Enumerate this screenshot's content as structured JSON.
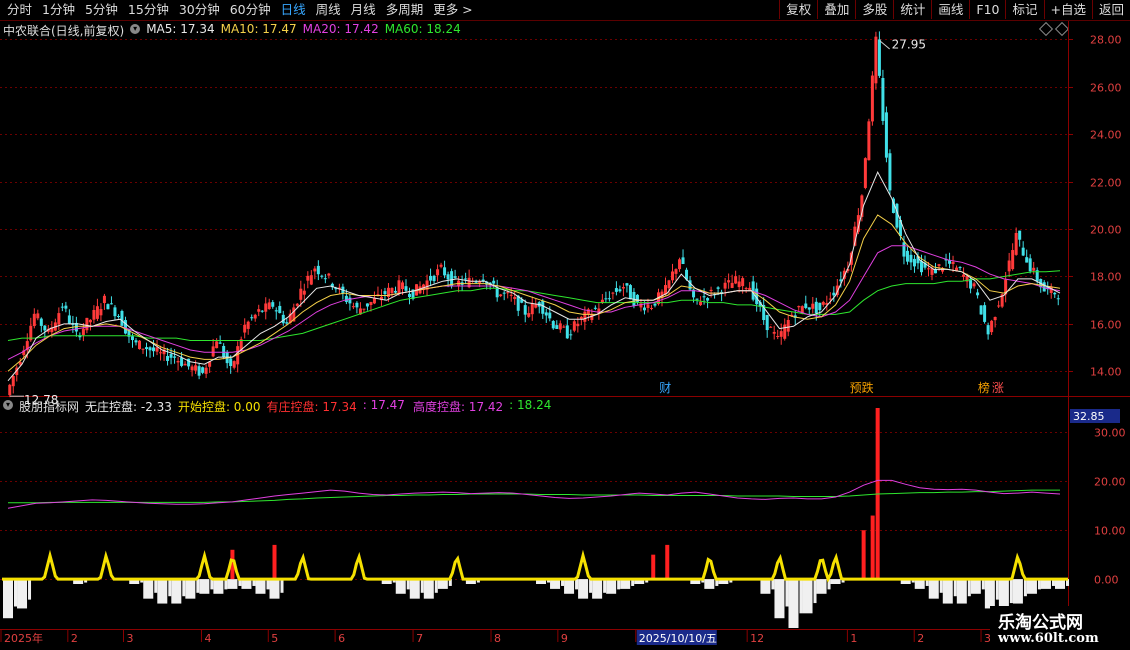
{
  "toolbar": {
    "periods": [
      {
        "label": "分时",
        "active": false
      },
      {
        "label": "1分钟",
        "active": false
      },
      {
        "label": "5分钟",
        "active": false
      },
      {
        "label": "15分钟",
        "active": false
      },
      {
        "label": "30分钟",
        "active": false
      },
      {
        "label": "60分钟",
        "active": false
      },
      {
        "label": "日线",
        "active": true
      },
      {
        "label": "周线",
        "active": false
      },
      {
        "label": "月线",
        "active": false
      },
      {
        "label": "多周期",
        "active": false
      },
      {
        "label": "更多 >",
        "active": false
      }
    ],
    "buttons": [
      "复权",
      "叠加",
      "多股",
      "统计",
      "画线",
      "F10",
      "标记",
      "+自选",
      "返回"
    ]
  },
  "main_legend": {
    "stock": "中农联合(日线,前复权)",
    "items": [
      {
        "text": "MA5: 17.34",
        "color": "#e8e8e8"
      },
      {
        "text": "MA10: 17.47",
        "color": "#f5d14a"
      },
      {
        "text": "MA20: 17.42",
        "color": "#e040e0"
      },
      {
        "text": "MA60: 18.24",
        "color": "#2ee62e"
      }
    ]
  },
  "sub_legend": {
    "title": "股朋指标网",
    "items": [
      {
        "text": "无庄控盘: -2.33",
        "color": "#e8e8e8"
      },
      {
        "text": "开始控盘: 0.00",
        "color": "#f5e000"
      },
      {
        "text": "有庄控盘: 17.34",
        "color": "#ff3030"
      },
      {
        "text": ": 17.47",
        "color": "#e040e0"
      },
      {
        "text": "高度控盘: 17.42",
        "color": "#e040e0"
      },
      {
        "text": ": 18.24",
        "color": "#2ee62e"
      }
    ]
  },
  "watermark": {
    "line1": "乐淘公式网",
    "line2": "www.60lt.com"
  },
  "chart_data": [
    {
      "type": "candlestick",
      "ylim": [
        13.0,
        28.4
      ],
      "yticks": [
        "28.00",
        "26.00",
        "24.00",
        "22.00",
        "20.00",
        "18.00",
        "16.00",
        "14.00"
      ],
      "ytick_values": [
        28,
        26,
        24,
        22,
        20,
        18,
        16,
        14
      ],
      "annotations": [
        {
          "text": "27.95",
          "kind": "high"
        },
        {
          "text": "12.78",
          "kind": "low"
        }
      ],
      "markers": [
        {
          "text": "财",
          "color": "#37a7ff"
        },
        {
          "text": "预跌",
          "color": "#f5a000"
        },
        {
          "text": "榜",
          "color": "#f5a000"
        },
        {
          "text": "涨",
          "color": "#ff5050"
        }
      ],
      "close_path": [
        13.0,
        14.6,
        16.4,
        15.6,
        16.8,
        15.5,
        16.2,
        17.0,
        16.4,
        15.2,
        15.0,
        14.7,
        14.6,
        14.2,
        13.9,
        15.4,
        14.0,
        15.9,
        16.5,
        16.8,
        16.0,
        17.4,
        18.4,
        17.9,
        17.2,
        16.6,
        16.9,
        17.3,
        17.6,
        17.3,
        17.8,
        18.3,
        17.7,
        17.8,
        18.0,
        17.3,
        17.1,
        16.5,
        16.9,
        16.0,
        15.6,
        16.2,
        16.6,
        17.2,
        17.6,
        16.8,
        16.8,
        17.4,
        18.8,
        16.9,
        17.2,
        17.5,
        17.8,
        17.6,
        16.2,
        15.3,
        16.4,
        16.8,
        16.6,
        17.4,
        18.5,
        21.5,
        27.9,
        21.5,
        19.0,
        18.5,
        18.2,
        18.6,
        18.2,
        17.5,
        15.6,
        17.4,
        19.7,
        18.4,
        17.4,
        17.3
      ],
      "ma5": [
        13.6,
        14.3,
        15.4,
        15.8,
        16.0,
        16.0,
        15.9,
        16.1,
        16.2,
        15.7,
        15.3,
        14.9,
        14.7,
        14.4,
        14.3,
        14.6,
        14.6,
        15.1,
        15.6,
        15.9,
        16.3,
        16.9,
        17.5,
        17.6,
        17.4,
        17.2,
        17.1,
        17.0,
        17.3,
        17.4,
        17.6,
        17.8,
        17.9,
        17.8,
        17.8,
        17.5,
        17.3,
        16.9,
        16.8,
        16.5,
        16.2,
        16.2,
        16.4,
        16.8,
        17.1,
        17.0,
        17.0,
        17.3,
        18.1,
        17.5,
        17.2,
        17.3,
        17.4,
        17.4,
        16.6,
        15.8,
        15.9,
        16.3,
        16.5,
        17.2,
        18.5,
        21.0,
        22.4,
        21.3,
        19.8,
        18.7,
        18.3,
        18.3,
        18.2,
        17.8,
        17.0,
        17.2,
        17.9,
        17.9,
        17.6,
        17.3
      ],
      "ma10": [
        14.0,
        14.5,
        15.1,
        15.5,
        15.8,
        15.9,
        15.9,
        16.0,
        15.9,
        15.6,
        15.3,
        15.0,
        14.8,
        14.6,
        14.5,
        14.5,
        14.6,
        14.9,
        15.2,
        15.6,
        16.0,
        16.5,
        16.9,
        17.2,
        17.3,
        17.2,
        17.2,
        17.2,
        17.3,
        17.4,
        17.5,
        17.6,
        17.7,
        17.7,
        17.7,
        17.6,
        17.4,
        17.2,
        17.0,
        16.8,
        16.5,
        16.4,
        16.4,
        16.6,
        16.9,
        17.0,
        17.0,
        17.2,
        17.6,
        17.5,
        17.3,
        17.3,
        17.4,
        17.4,
        17.0,
        16.5,
        16.3,
        16.2,
        16.3,
        16.8,
        17.8,
        19.6,
        20.6,
        20.2,
        19.4,
        18.8,
        18.4,
        18.3,
        18.2,
        17.9,
        17.4,
        17.3,
        17.6,
        17.7,
        17.6,
        17.5
      ],
      "ma20": [
        14.5,
        14.8,
        15.2,
        15.5,
        15.7,
        15.8,
        15.9,
        15.9,
        15.9,
        15.7,
        15.5,
        15.3,
        15.1,
        14.9,
        14.8,
        14.8,
        14.8,
        14.9,
        15.1,
        15.4,
        15.7,
        16.1,
        16.5,
        16.8,
        17.0,
        17.1,
        17.2,
        17.2,
        17.3,
        17.4,
        17.5,
        17.6,
        17.6,
        17.6,
        17.6,
        17.6,
        17.5,
        17.4,
        17.2,
        17.0,
        16.8,
        16.6,
        16.5,
        16.5,
        16.7,
        16.8,
        16.9,
        17.1,
        17.4,
        17.4,
        17.3,
        17.3,
        17.4,
        17.4,
        17.2,
        16.9,
        16.6,
        16.4,
        16.3,
        16.5,
        17.0,
        18.0,
        19.0,
        19.3,
        19.3,
        19.1,
        18.9,
        18.7,
        18.6,
        18.4,
        18.1,
        17.9,
        17.8,
        17.7,
        17.5,
        17.4
      ],
      "ma60": [
        15.3,
        15.4,
        15.4,
        15.5,
        15.5,
        15.5,
        15.5,
        15.5,
        15.5,
        15.5,
        15.4,
        15.4,
        15.4,
        15.3,
        15.3,
        15.3,
        15.3,
        15.3,
        15.3,
        15.4,
        15.5,
        15.6,
        15.8,
        16.0,
        16.2,
        16.4,
        16.6,
        16.8,
        17.0,
        17.1,
        17.2,
        17.3,
        17.4,
        17.4,
        17.5,
        17.5,
        17.4,
        17.4,
        17.3,
        17.2,
        17.1,
        17.0,
        16.9,
        16.9,
        16.9,
        16.9,
        16.9,
        16.9,
        17.0,
        17.0,
        16.9,
        16.9,
        16.8,
        16.8,
        16.7,
        16.6,
        16.5,
        16.4,
        16.4,
        16.4,
        16.5,
        17.0,
        17.4,
        17.6,
        17.7,
        17.7,
        17.7,
        17.8,
        17.8,
        17.9,
        17.9,
        18.0,
        18.1,
        18.2,
        18.2,
        18.24
      ]
    },
    {
      "type": "bar",
      "ylim": [
        -10.0,
        35.0
      ],
      "yticks": [
        "30.00",
        "20.00",
        "10.00",
        "0.00"
      ],
      "ytick_values": [
        30,
        20,
        10,
        0
      ],
      "top_value": "32.85",
      "bars": [
        -8,
        -6,
        0,
        0,
        0,
        -1,
        0,
        0,
        0,
        -1,
        -4,
        -5,
        -5,
        -4,
        -3,
        -3,
        -2,
        -2,
        -3,
        -4,
        0,
        0,
        0,
        0,
        0,
        0,
        0,
        -1,
        -3,
        -4,
        -4,
        -2,
        0,
        -1,
        0,
        0,
        0,
        0,
        -1,
        -2,
        -3,
        -4,
        -4,
        -3,
        -2,
        -1,
        0,
        0,
        0,
        -1,
        -2,
        -1,
        0,
        0,
        -3,
        -8,
        -10,
        -7,
        -3,
        -1,
        0,
        0,
        0,
        0,
        -1,
        -2,
        -4,
        -5,
        -5,
        -3,
        -6,
        -7,
        -5,
        -3,
        -2,
        -2
      ],
      "red_bars": [
        {
          "index": 16,
          "value": 6
        },
        {
          "index": 19,
          "value": 7
        },
        {
          "index": 46,
          "value": 5
        },
        {
          "index": 47,
          "value": 7
        },
        {
          "index": 61,
          "value": 10
        },
        {
          "index": 62,
          "value": 35
        }
      ],
      "yellow_peaks": [
        3,
        7,
        14,
        16,
        21,
        25,
        32,
        41,
        50,
        55,
        58,
        59,
        72
      ],
      "line_magenta": [
        14.5,
        15.0,
        15.5,
        15.6,
        15.8,
        16.0,
        16.2,
        16.1,
        15.9,
        15.7,
        15.5,
        15.4,
        15.3,
        15.3,
        15.4,
        15.6,
        15.8,
        16.2,
        16.6,
        17.0,
        17.3,
        17.6,
        17.9,
        18.2,
        18.0,
        17.6,
        17.3,
        17.2,
        17.4,
        17.6,
        17.7,
        17.8,
        17.7,
        17.5,
        17.6,
        17.7,
        17.6,
        17.3,
        17.0,
        16.7,
        16.5,
        16.6,
        16.8,
        17.0,
        17.3,
        17.6,
        17.4,
        17.2,
        17.6,
        17.8,
        17.4,
        17.0,
        16.6,
        16.4,
        16.3,
        16.5,
        16.6,
        16.4,
        16.4,
        16.8,
        17.8,
        19.2,
        20.2,
        20.2,
        19.4,
        18.7,
        18.4,
        18.3,
        18.4,
        18.2,
        17.8,
        17.5,
        17.6,
        17.8,
        17.6,
        17.4
      ],
      "line_green": [
        15.6,
        15.6,
        15.6,
        15.7,
        15.7,
        15.7,
        15.7,
        15.7,
        15.7,
        15.7,
        15.7,
        15.7,
        15.7,
        15.7,
        15.7,
        15.8,
        15.8,
        15.9,
        16.0,
        16.1,
        16.3,
        16.4,
        16.6,
        16.7,
        16.8,
        16.9,
        17.0,
        17.1,
        17.1,
        17.2,
        17.2,
        17.3,
        17.3,
        17.4,
        17.4,
        17.4,
        17.4,
        17.4,
        17.3,
        17.3,
        17.3,
        17.2,
        17.2,
        17.2,
        17.2,
        17.2,
        17.1,
        17.1,
        17.1,
        17.1,
        17.1,
        17.1,
        17.0,
        17.0,
        17.0,
        17.0,
        16.9,
        16.9,
        16.9,
        16.9,
        17.0,
        17.2,
        17.4,
        17.5,
        17.6,
        17.7,
        17.7,
        17.8,
        17.8,
        17.9,
        17.9,
        18.0,
        18.1,
        18.2,
        18.2,
        18.2
      ]
    },
    {
      "type": "x-axis",
      "labels": [
        "2025年",
        "2",
        "3",
        "4",
        "5",
        "6",
        "7",
        "8",
        "9",
        "2025/10/10/五",
        "12",
        "1",
        "2",
        "3"
      ],
      "label_index": [
        0,
        6,
        11,
        18,
        24,
        30,
        37,
        44,
        50,
        57,
        67,
        76,
        82,
        88
      ],
      "highlight": "2025/10/10/五"
    }
  ]
}
